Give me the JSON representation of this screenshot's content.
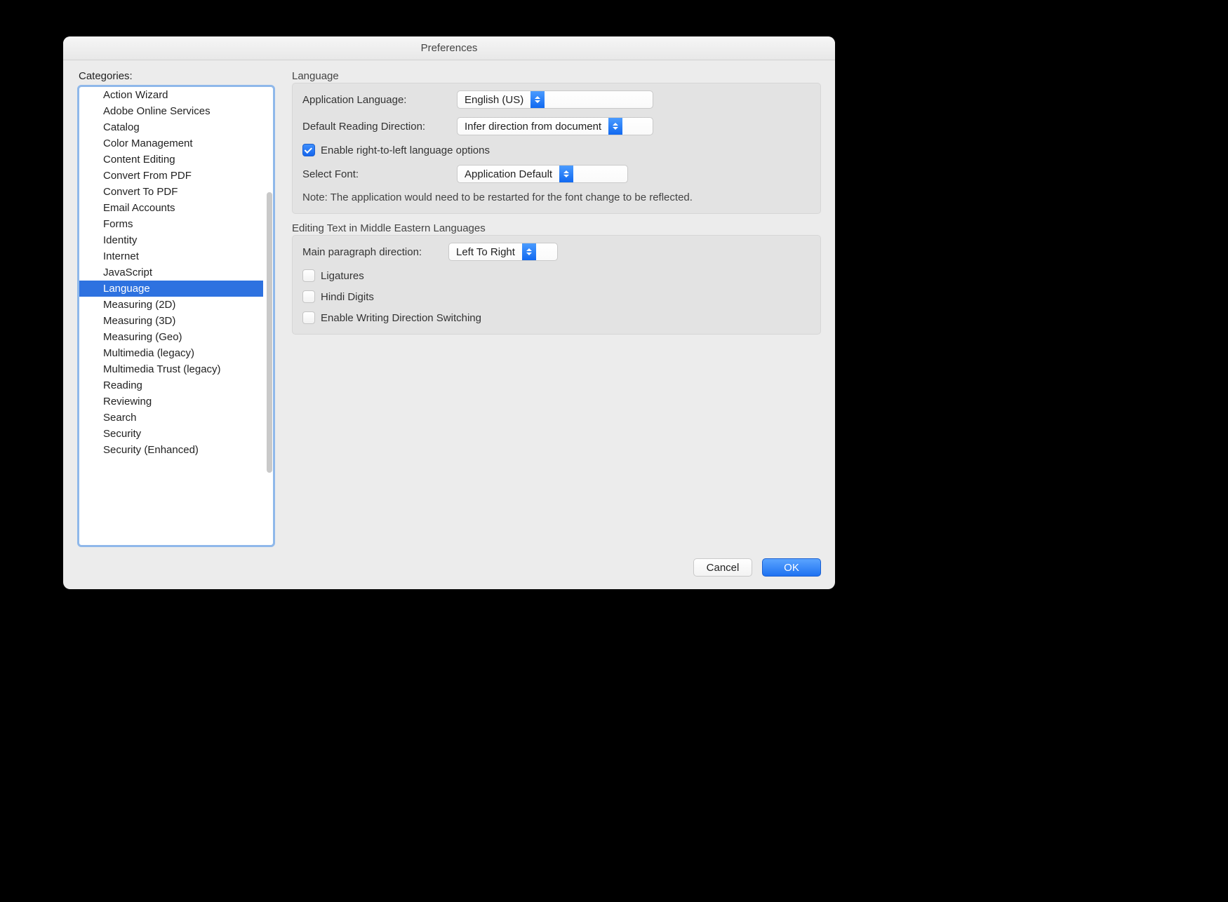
{
  "window": {
    "title": "Preferences"
  },
  "sidebar": {
    "label": "Categories:",
    "items": [
      "Action Wizard",
      "Adobe Online Services",
      "Catalog",
      "Color Management",
      "Content Editing",
      "Convert From PDF",
      "Convert To PDF",
      "Email Accounts",
      "Forms",
      "Identity",
      "Internet",
      "JavaScript",
      "Language",
      "Measuring (2D)",
      "Measuring (3D)",
      "Measuring (Geo)",
      "Multimedia (legacy)",
      "Multimedia Trust (legacy)",
      "Reading",
      "Reviewing",
      "Search",
      "Security",
      "Security (Enhanced)"
    ],
    "selected_index": 12
  },
  "panel": {
    "language": {
      "heading": "Language",
      "app_lang_label": "Application Language:",
      "app_lang_value": "English (US)",
      "reading_dir_label": "Default Reading Direction:",
      "reading_dir_value": "Infer direction from document",
      "rtl_checkbox_label": "Enable right-to-left language options",
      "rtl_checked": true,
      "select_font_label": "Select Font:",
      "select_font_value": "Application Default",
      "note": "Note: The application would need to be restarted for the font change to be reflected."
    },
    "editing": {
      "heading": "Editing Text in Middle Eastern Languages",
      "para_dir_label": "Main paragraph direction:",
      "para_dir_value": "Left To Right",
      "ligatures_label": "Ligatures",
      "ligatures_checked": false,
      "hindi_label": "Hindi Digits",
      "hindi_checked": false,
      "wds_label": "Enable Writing Direction Switching",
      "wds_checked": false
    }
  },
  "footer": {
    "cancel": "Cancel",
    "ok": "OK"
  }
}
